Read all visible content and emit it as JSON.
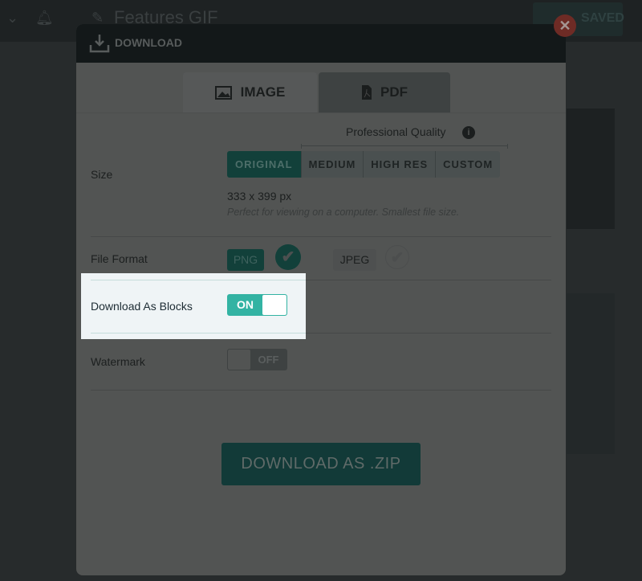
{
  "background": {
    "document_title": "Features GIF",
    "saved_label": "SAVED"
  },
  "modal": {
    "title": "DOWNLOAD",
    "close_icon": "close-icon",
    "tabs": [
      {
        "label": "IMAGE",
        "icon": "image-icon",
        "active": true
      },
      {
        "label": "PDF",
        "icon": "pdf-icon",
        "active": false
      }
    ],
    "size": {
      "label": "Size",
      "group_label": "Professional Quality",
      "options": [
        "ORIGINAL",
        "MEDIUM",
        "HIGH RES",
        "CUSTOM"
      ],
      "selected": "ORIGINAL",
      "dimensions": "333 x 399 px",
      "description": "Perfect for viewing on a computer. Smallest file size."
    },
    "file_format": {
      "label": "File Format",
      "options": [
        "PNG",
        "JPEG"
      ],
      "selected": "PNG"
    },
    "blocks": {
      "label": "Download As Blocks",
      "state": "ON"
    },
    "watermark": {
      "label": "Watermark",
      "state": "OFF"
    },
    "download_button": "DOWNLOAD AS .ZIP"
  },
  "colors": {
    "accent": "#33b3a3",
    "highlight": "#eff4f6"
  }
}
